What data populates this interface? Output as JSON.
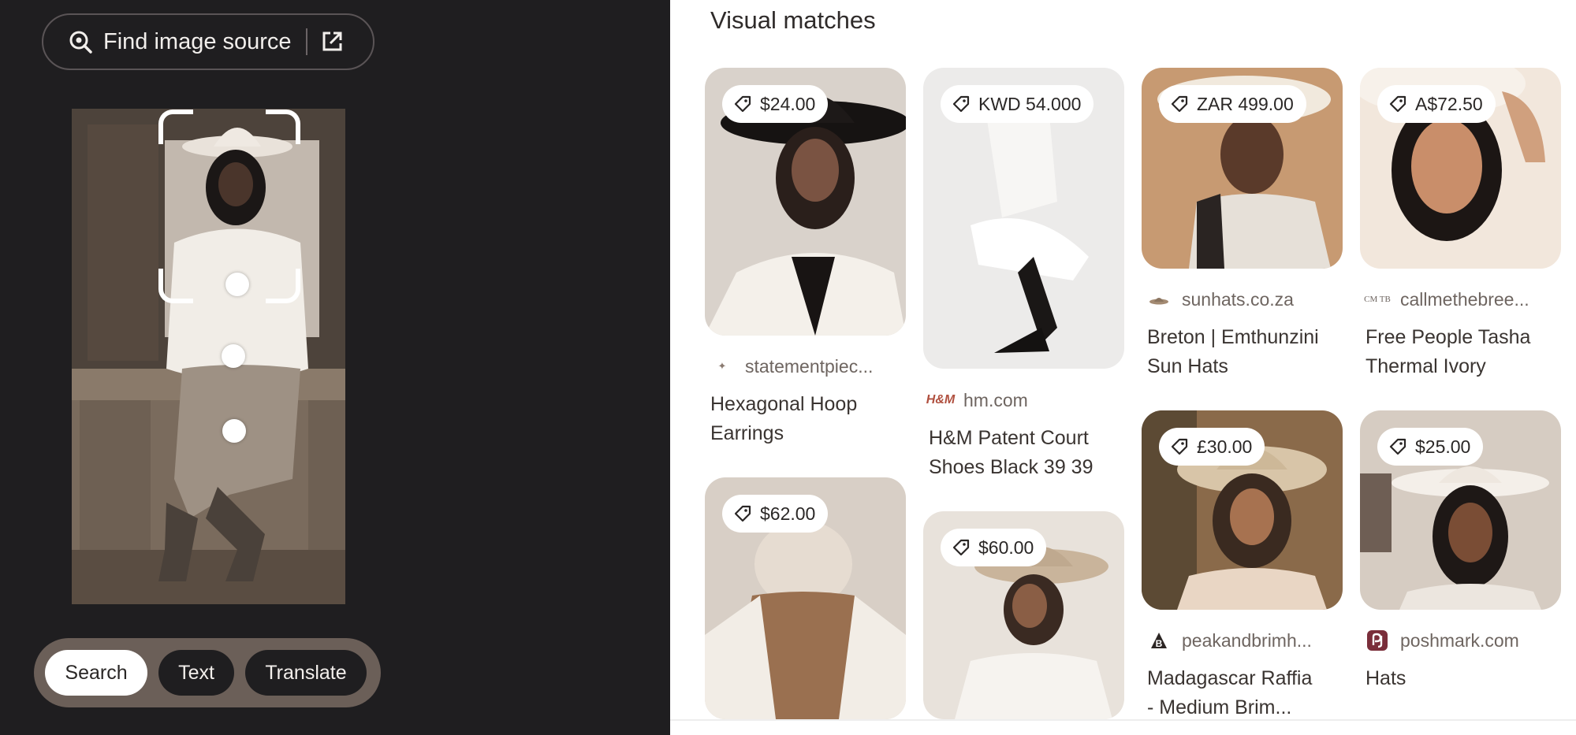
{
  "find_source": {
    "label": "Find image source"
  },
  "modes": {
    "search": "Search",
    "text": "Text",
    "translate": "Translate",
    "selected": "Search"
  },
  "results": {
    "title": "Visual matches",
    "items": [
      {
        "price": "$24.00",
        "source": "statementpiec...",
        "title_line1": "Hexagonal Hoop",
        "title_line2": "Earrings"
      },
      {
        "price": "KWD 54.000",
        "source": "hm.com",
        "title_line1": "H&M Patent Court",
        "title_line2": "Shoes Black 39 39"
      },
      {
        "price": "ZAR 499.00",
        "source": "sunhats.co.za",
        "title_line1": "Breton | Emthunzini",
        "title_line2": "Sun Hats"
      },
      {
        "price": "A$72.50",
        "source": "callmethebree...",
        "title_line1": "Free People Tasha",
        "title_line2": "Thermal Ivory"
      },
      {
        "price": "$62.00"
      },
      {
        "price": "$60.00"
      },
      {
        "price": "£30.00",
        "source": "peakandbrimh...",
        "title_line1": "Madagascar Raffia",
        "title_line2": "- Medium Brim..."
      },
      {
        "price": "$25.00",
        "source": "poshmark.com",
        "title_line1": "Hats"
      }
    ]
  },
  "favicons": {
    "hm": "H&M",
    "callme": "CM TB"
  },
  "colors": {
    "left_bg": "#1f1e20",
    "mode_bar": "#6b5f58",
    "accent_text": "#2f2b2a"
  }
}
